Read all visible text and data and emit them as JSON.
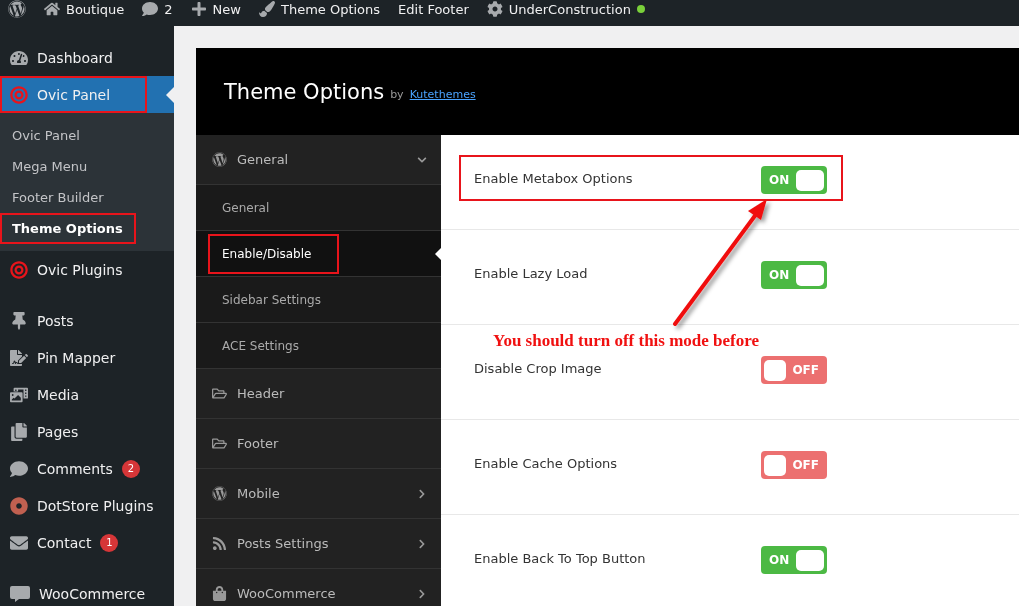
{
  "admin_bar": {
    "items": [
      {
        "kind": "logo"
      },
      {
        "kind": "site",
        "label": "Boutique"
      },
      {
        "kind": "comments",
        "label": "2"
      },
      {
        "kind": "new",
        "label": "New"
      },
      {
        "kind": "brush",
        "label": "Theme Options"
      },
      {
        "kind": "plain",
        "label": "Edit Footer"
      },
      {
        "kind": "cog",
        "label": "UnderConstruction"
      }
    ]
  },
  "sidebar": {
    "sections": [
      {
        "items": [
          {
            "label": "Dashboard",
            "selected": false,
            "highlighted": false
          },
          {
            "label": "Ovic Panel",
            "selected": true,
            "highlighted": true,
            "children": [
              {
                "label": "Ovic Panel",
                "selected": false,
                "highlighted": false
              },
              {
                "label": "Mega Menu",
                "selected": false,
                "highlighted": false
              },
              {
                "label": "Footer Builder",
                "selected": false,
                "highlighted": false
              },
              {
                "label": "Theme Options",
                "selected": true,
                "highlighted": true
              }
            ]
          },
          {
            "label": "Ovic Plugins",
            "selected": false,
            "highlighted": false
          }
        ]
      },
      {
        "items": [
          {
            "label": "Posts",
            "selected": false,
            "highlighted": false
          },
          {
            "label": "Pin Mapper",
            "selected": false,
            "highlighted": false
          },
          {
            "label": "Media",
            "selected": false,
            "highlighted": false
          },
          {
            "label": "Pages",
            "selected": false,
            "highlighted": false
          },
          {
            "label": "Comments",
            "selected": false,
            "highlighted": false,
            "badge": "2"
          },
          {
            "label": "DotStore Plugins",
            "selected": false,
            "highlighted": false
          },
          {
            "label": "Contact",
            "selected": false,
            "highlighted": false,
            "badge": "1"
          }
        ]
      },
      {
        "items": [
          {
            "label": "WooCommerce",
            "selected": false,
            "highlighted": false
          }
        ]
      }
    ]
  },
  "panel": {
    "title": "Theme Options",
    "by": "by",
    "author": "Kutethemes",
    "nav": [
      {
        "label": "General",
        "kind": "wordpress",
        "expanded": true,
        "children": [
          {
            "label": "General",
            "selected": false,
            "highlighted": false
          },
          {
            "label": "Enable/Disable",
            "selected": true,
            "highlighted": true
          },
          {
            "label": "Sidebar Settings",
            "selected": false,
            "highlighted": false
          },
          {
            "label": "ACE Settings",
            "selected": false,
            "highlighted": false
          }
        ]
      },
      {
        "label": "Header",
        "kind": "folder",
        "expanded": false
      },
      {
        "label": "Footer",
        "kind": "folder",
        "expanded": false
      },
      {
        "label": "Mobile",
        "kind": "wordpress",
        "expanded": false
      },
      {
        "label": "Posts Settings",
        "kind": "rss",
        "expanded": false
      },
      {
        "label": "WooCommerce",
        "kind": "bag",
        "expanded": false
      }
    ],
    "options": [
      {
        "label": "Enable Metabox Options",
        "on": true,
        "toggle_label": "ON",
        "highlighted": true
      },
      {
        "label": "Enable Lazy Load",
        "on": true,
        "toggle_label": "ON",
        "highlighted": false
      },
      {
        "label": "Disable Crop Image",
        "on": false,
        "toggle_label": "OFF",
        "highlighted": false
      },
      {
        "label": "Enable Cache Options",
        "on": false,
        "toggle_label": "OFF",
        "highlighted": false
      },
      {
        "label": "Enable Back To Top Button",
        "on": true,
        "toggle_label": "ON",
        "highlighted": false
      }
    ],
    "annotation": {
      "text": "You should turn off this mode before"
    }
  }
}
